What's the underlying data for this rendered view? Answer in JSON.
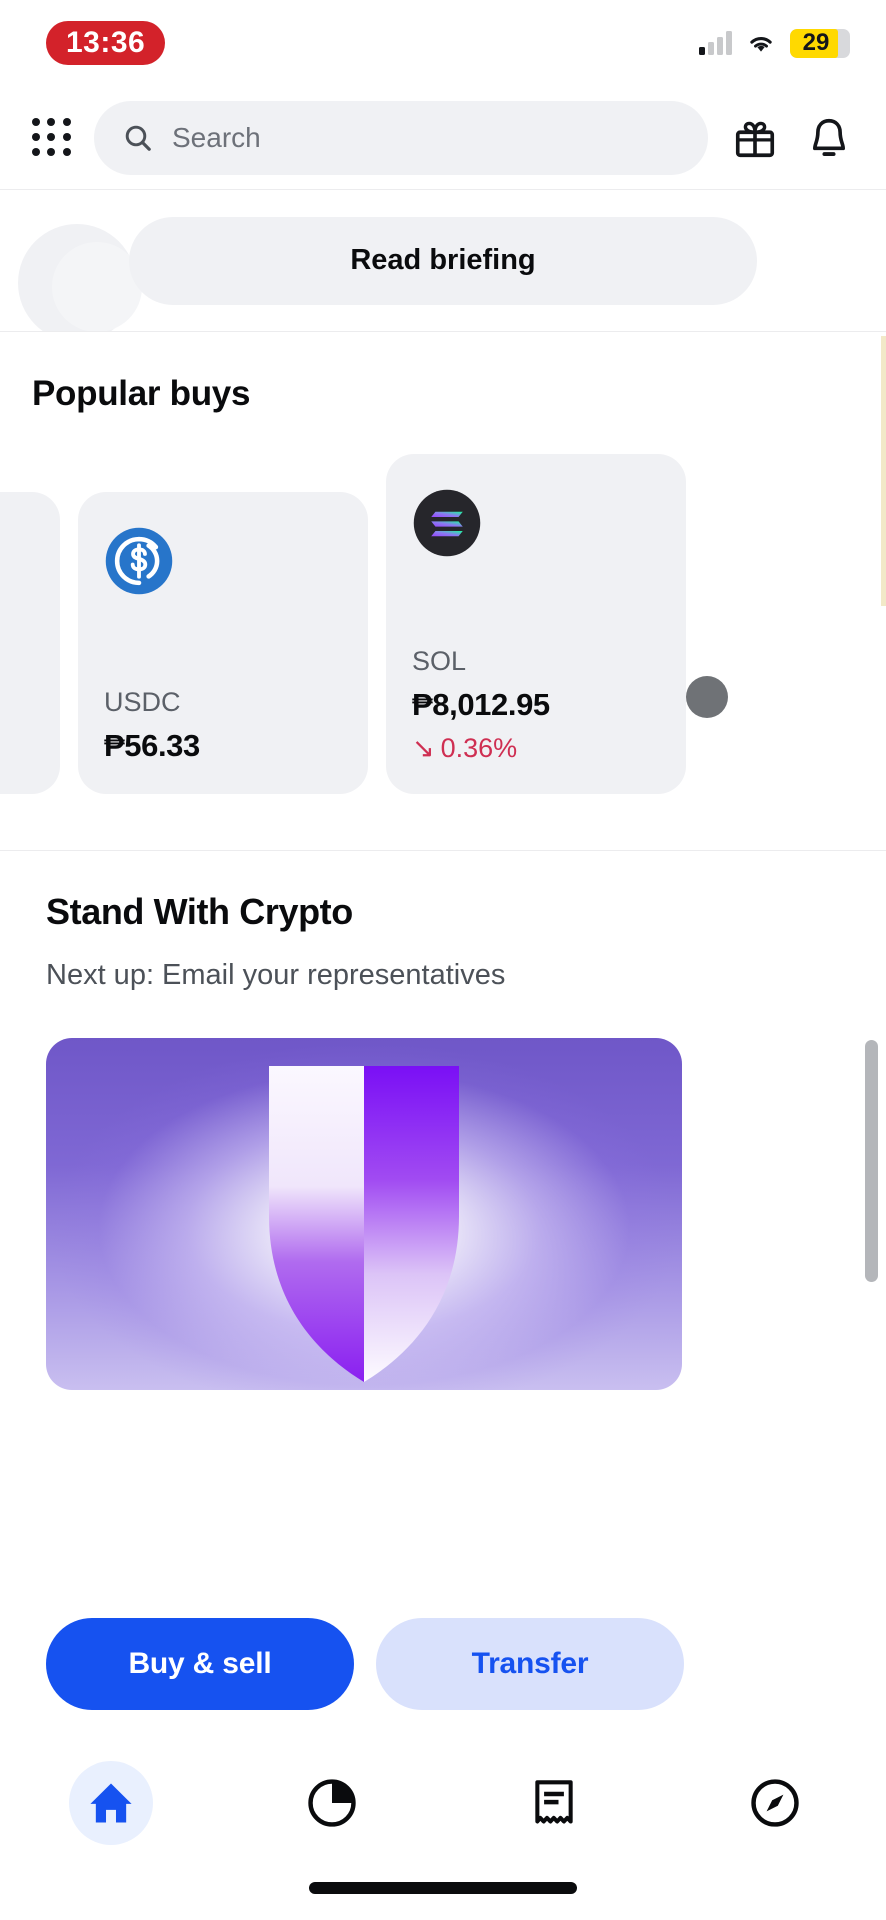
{
  "status_bar": {
    "time": "13:36",
    "time_bg": "#d3222a",
    "battery_level": "29",
    "battery_fill_color": "#ffd900",
    "signal_icon": "cellular-signal-icon",
    "wifi_icon": "wifi-icon"
  },
  "header": {
    "apps_icon": "grid-apps-icon",
    "search": {
      "placeholder": "Search",
      "icon": "search-icon"
    },
    "gift_icon": "gift-icon",
    "bell_icon": "bell-notification-icon"
  },
  "briefing": {
    "label": "Read briefing"
  },
  "popular_buys": {
    "title": "Popular buys",
    "cards": [
      {
        "symbol": "USDC",
        "price": "₱56.33",
        "logo": "usdc-coin-icon",
        "logo_color": "#2775ca"
      },
      {
        "symbol": "SOL",
        "price": "₱8,012.95",
        "change": "0.36%",
        "change_arrow": "↘",
        "change_color": "#cf2f52",
        "logo": "solana-coin-icon"
      }
    ]
  },
  "stand_with_crypto": {
    "title": "Stand With Crypto",
    "subtitle": "Next up: Email your representatives",
    "hero_image": "purple-shield-illustration"
  },
  "actions": {
    "buy_sell": "Buy & sell",
    "transfer": "Transfer",
    "primary_color": "#1652f0",
    "secondary_bg": "#d9e1fc"
  },
  "bottom_nav": {
    "items": [
      {
        "name": "home",
        "icon": "home-icon",
        "active": true
      },
      {
        "name": "portfolio",
        "icon": "pie-chart-icon",
        "active": false
      },
      {
        "name": "transactions",
        "icon": "receipt-icon",
        "active": false
      },
      {
        "name": "explore",
        "icon": "compass-icon",
        "active": false
      }
    ],
    "active_color": "#1652f0"
  }
}
